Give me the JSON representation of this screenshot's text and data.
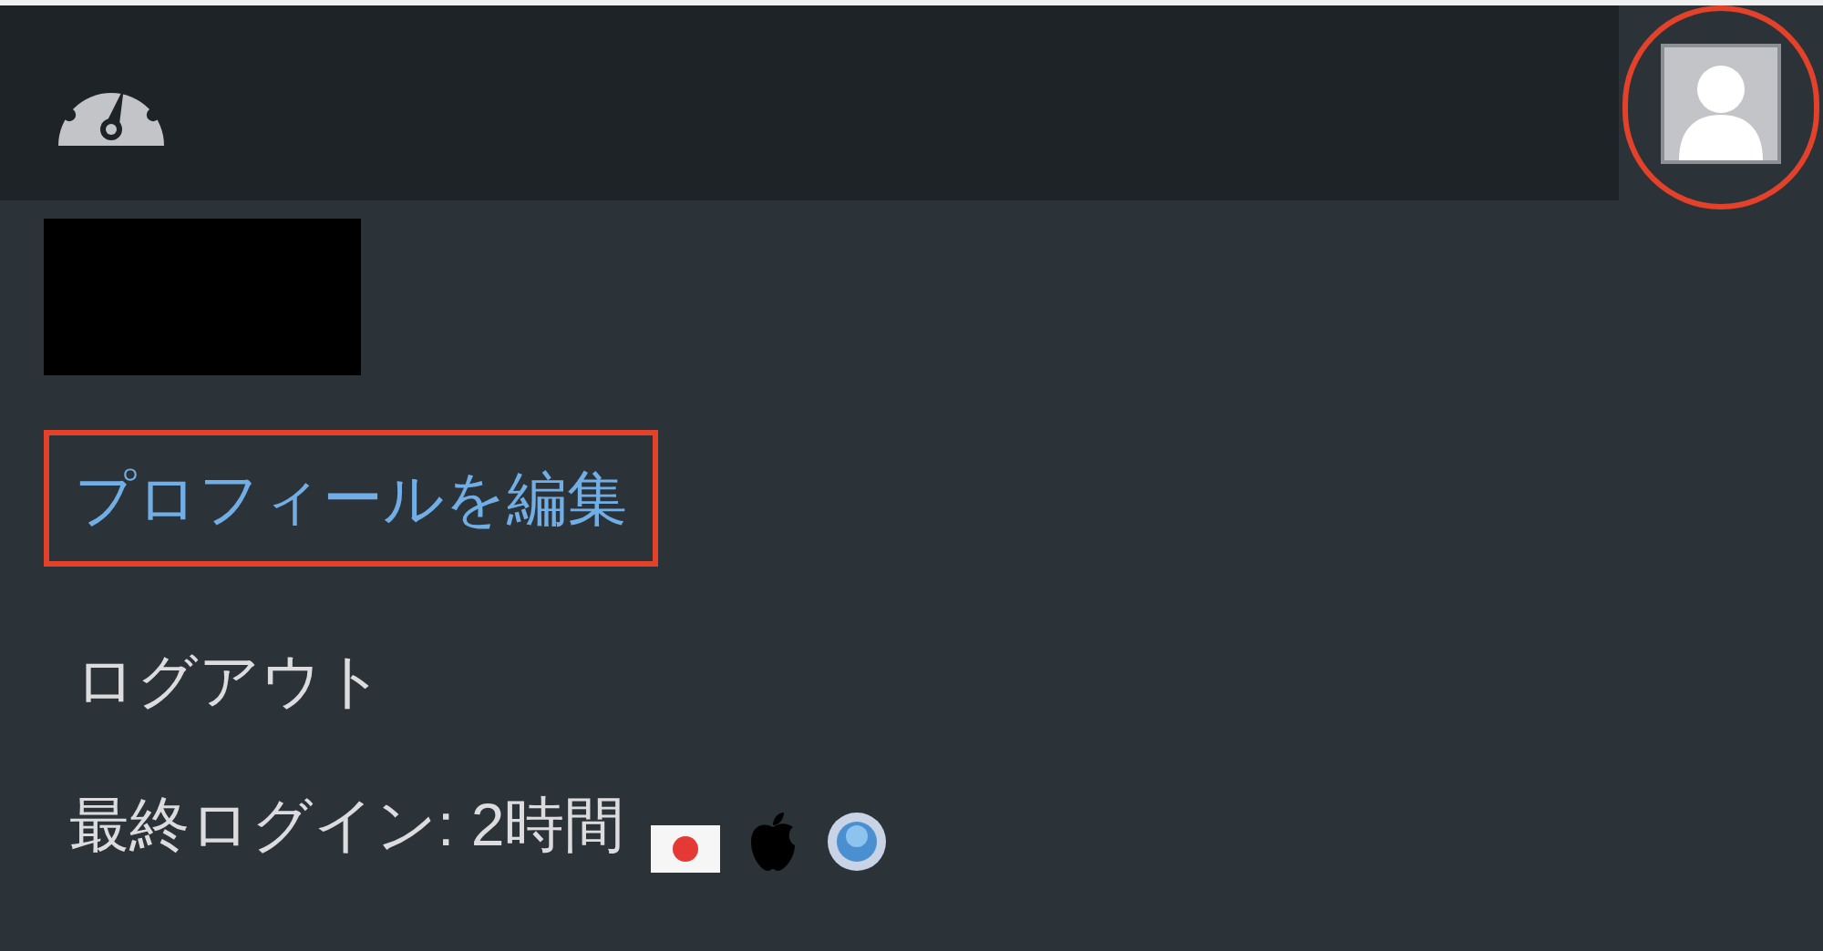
{
  "toolbar": {
    "avatar": {
      "annotated": true
    }
  },
  "user_menu": {
    "items": [
      {
        "label": "プロフィールを編集",
        "selected": true,
        "annotated": true
      },
      {
        "label": "ログアウト",
        "selected": false,
        "annotated": false
      }
    ],
    "last_login": "最終ログイン: 2時間"
  }
}
